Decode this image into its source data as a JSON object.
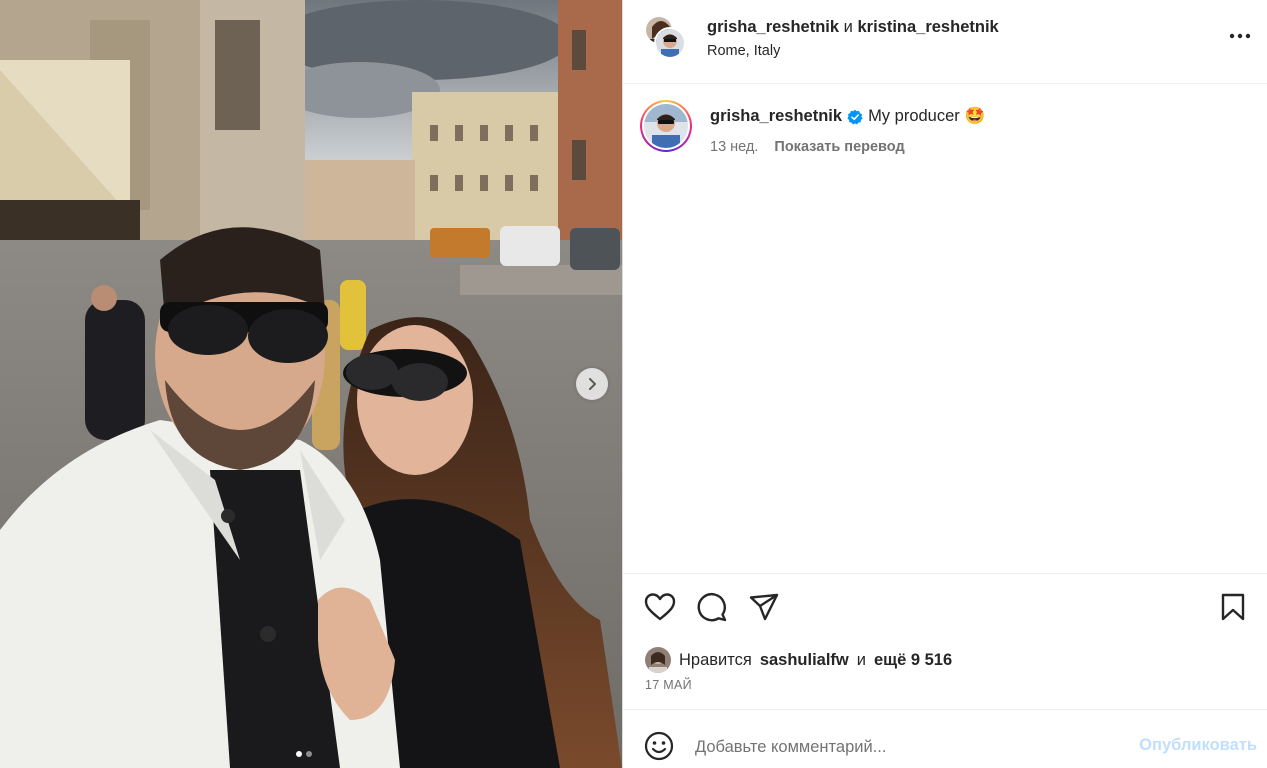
{
  "header": {
    "author1": "grisha_reshetnik",
    "conjunction": "и",
    "author2": "kristina_reshetnik",
    "location": "Rome, Italy",
    "more_icon": "more-horizontal-icon"
  },
  "caption": {
    "username": "grisha_reshetnik",
    "text": "My producer",
    "emoji": "🤩",
    "time_ago": "13 нед.",
    "translate_label": "Показать перевод",
    "verified_icon": "verified-badge-icon"
  },
  "carousel": {
    "total_slides": 2,
    "current_slide": 1,
    "next_icon": "chevron-right-icon"
  },
  "actions": {
    "like_icon": "heart-icon",
    "comment_icon": "comment-icon",
    "share_icon": "share-icon",
    "save_icon": "bookmark-icon"
  },
  "likes": {
    "prefix": "Нравится",
    "user": "sashulialfw",
    "conjunction": "и",
    "others": "ещё 9 516"
  },
  "date": "17 МАЙ",
  "comment": {
    "placeholder": "Добавьте комментарий...",
    "post_label": "Опубликовать",
    "emoji_icon": "smiley-icon"
  },
  "colors": {
    "text": "#262626",
    "secondary": "#737373",
    "verified": "#0095f6",
    "post_disabled": "#c0dffd",
    "divider": "#efefef"
  }
}
